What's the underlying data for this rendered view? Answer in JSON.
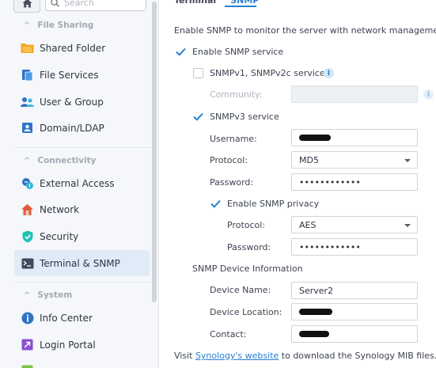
{
  "sidebar": {
    "search_placeholder": "Search",
    "sections": [
      {
        "label": "File Sharing"
      },
      {
        "label": "Connectivity"
      },
      {
        "label": "System"
      }
    ],
    "items": [
      {
        "label": "Shared Folder",
        "icon": "shared-folder-icon"
      },
      {
        "label": "File Services",
        "icon": "file-services-icon"
      },
      {
        "label": "User & Group",
        "icon": "user-group-icon"
      },
      {
        "label": "Domain/LDAP",
        "icon": "domain-ldap-icon"
      },
      {
        "label": "External Access",
        "icon": "external-access-icon"
      },
      {
        "label": "Network",
        "icon": "network-icon"
      },
      {
        "label": "Security",
        "icon": "security-icon"
      },
      {
        "label": "Terminal & SNMP",
        "icon": "terminal-icon",
        "active": true
      },
      {
        "label": "Info Center",
        "icon": "info-center-icon"
      },
      {
        "label": "Login Portal",
        "icon": "login-portal-icon"
      }
    ]
  },
  "tabs": [
    {
      "label": "Terminal",
      "active": false
    },
    {
      "label": "SNMP",
      "active": true
    }
  ],
  "snmp": {
    "description": "Enable SNMP to monitor the server with network management",
    "enable_label": "Enable SNMP service",
    "enable_checked": true,
    "v1v2c_label": "SNMPv1, SNMPv2c service",
    "v1v2c_checked": false,
    "community_label": "Community:",
    "community_value": "",
    "v3_label": "SNMPv3 service",
    "v3_checked": true,
    "username_label": "Username:",
    "protocol_label": "Protocol:",
    "protocol_value": "MD5",
    "password_label": "Password:",
    "password_value": "••••••••••••",
    "privacy_label": "Enable SNMP privacy",
    "privacy_checked": true,
    "privacy_protocol_label": "Protocol:",
    "privacy_protocol_value": "AES",
    "privacy_password_label": "Password:",
    "privacy_password_value": "••••••••••••",
    "device_info_title": "SNMP Device Information",
    "device_name_label": "Device Name:",
    "device_name_value": "Server2",
    "device_location_label": "Device Location:",
    "contact_label": "Contact:"
  },
  "footer": {
    "prefix": "Visit ",
    "link": "Synology's website",
    "suffix": " to download the Synology MIB files."
  },
  "colors": {
    "accent": "#2a7fd4",
    "active_item_bg": "#e1ebf7"
  }
}
